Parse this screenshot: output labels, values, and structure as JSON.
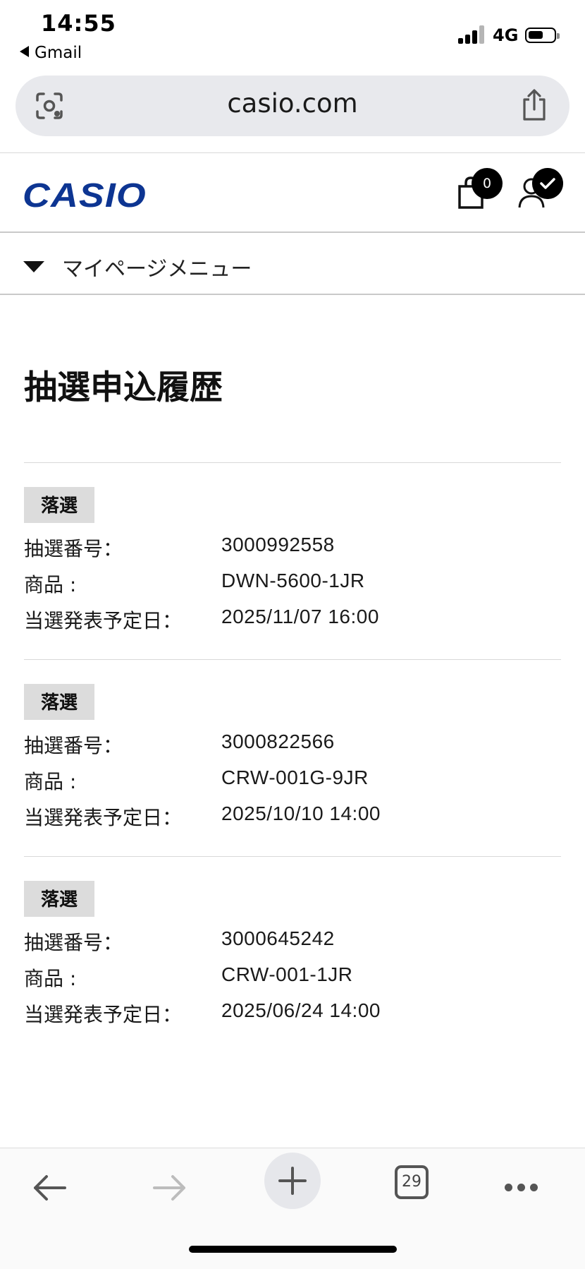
{
  "status_bar": {
    "time": "14:55",
    "back_app": "Gmail",
    "network": "4G"
  },
  "browser": {
    "url": "casio.com",
    "tab_count": "29"
  },
  "header": {
    "logo": "CASIO",
    "cart_count": "0",
    "brand_color": "#0d3592"
  },
  "menu": {
    "label": "マイページメニュー"
  },
  "page": {
    "title": "抽選申込履歴"
  },
  "labels": {
    "lottery_number": "抽選番号：",
    "product": "商品 :",
    "announcement_date": "当選発表予定日："
  },
  "entries": [
    {
      "status": "落選",
      "lottery_number": "3000992558",
      "product": "DWN-5600-1JR",
      "announcement": "2025/11/07 16:00"
    },
    {
      "status": "落選",
      "lottery_number": "3000822566",
      "product": "CRW-001G-9JR",
      "announcement": "2025/10/10 14:00"
    },
    {
      "status": "落選",
      "lottery_number": "3000645242",
      "product": "CRW-001-1JR",
      "announcement": "2025/06/24 14:00"
    }
  ]
}
